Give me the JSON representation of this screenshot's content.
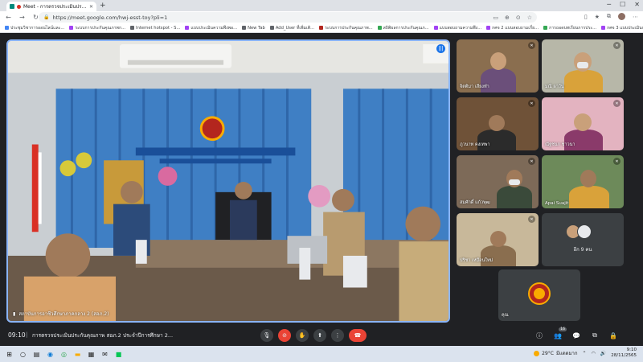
{
  "browser": {
    "tab_title": "Meet - การตรวจประเมินประกันคุณภาพ",
    "url": "https://meet.google.com/hwj-esst-toy?pli=1",
    "bookmarks": [
      {
        "label": "ประชุมวิชาการออนไลน์และ...",
        "color": "#4285f4"
      },
      {
        "label": "ระบบการประกันคุณภาพก...",
        "color": "#a142f4"
      },
      {
        "label": "Internet hotspot - S...",
        "color": "#5f6368"
      },
      {
        "label": "แบบประเมินความพึงพอ...",
        "color": "#a142f4"
      },
      {
        "label": "New Tab",
        "color": "#5f6368"
      },
      {
        "label": "Add_User ที่เพิ่มเติ...",
        "color": "#5f6368"
      },
      {
        "label": "ระบบการประกันคุณภาพ...",
        "color": "#b3261e"
      },
      {
        "label": "สถิติผลการประกันคุณภ...",
        "color": "#34a853"
      },
      {
        "label": "แบบสอบถามความพึง...",
        "color": "#a142f4"
      },
      {
        "label": "กศจ 2 แบบสอบถามเกี่ย...",
        "color": "#a142f4"
      },
      {
        "label": "การถอดบทเรียนการประ...",
        "color": "#34a853"
      },
      {
        "label": "กศจ 3 แบบประเมินก...",
        "color": "#a142f4"
      }
    ]
  },
  "meet": {
    "main_speaker": "สถาบันการอาชีวศึกษาภาคกลาง 2 (สอภ.2)",
    "tiles": [
      {
        "name": "จิตติมา เสียงทำ"
      },
      {
        "name": "มณี ผาวัน"
      },
      {
        "name": "ภูวนาท คงเทพา"
      },
      {
        "name": "ณัฐชนก ชาวนา"
      },
      {
        "name": "สมศักดิ์ แก้วพุฒ"
      },
      {
        "name": "Apai Suajit"
      },
      {
        "name": "ปริชา เหมือนใหม่"
      }
    ],
    "more_label": "อีก 9 คน",
    "logo_tile_name": "คุณ",
    "clock": "09:10",
    "separator": "|",
    "meeting_title": "การตรวจประเมินประกันคุณภาพ สอภ.2 ประจำปีการศึกษา 2...",
    "people_count": "16"
  },
  "taskbar": {
    "weather_temp": "29°C",
    "weather_text": "มีแดดมาก",
    "time": "9:10",
    "date": "28/11/2565"
  }
}
